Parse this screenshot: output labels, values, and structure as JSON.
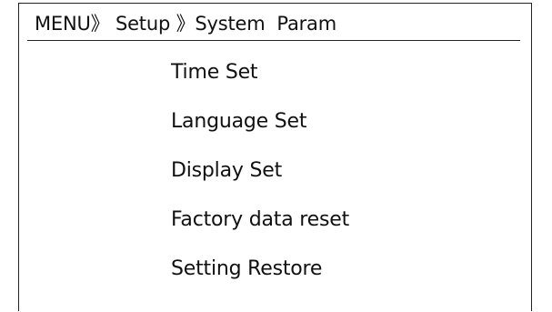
{
  "breadcrumb": {
    "menu": "MENU",
    "sep1": "》",
    "setup": " Setup ",
    "sep2": "》",
    "system_param": "System  Param"
  },
  "menu": {
    "items": [
      {
        "label": "Time Set"
      },
      {
        "label": "Language Set"
      },
      {
        "label": "Display Set"
      },
      {
        "label": "Factory data reset"
      },
      {
        "label": "Setting Restore"
      }
    ]
  }
}
